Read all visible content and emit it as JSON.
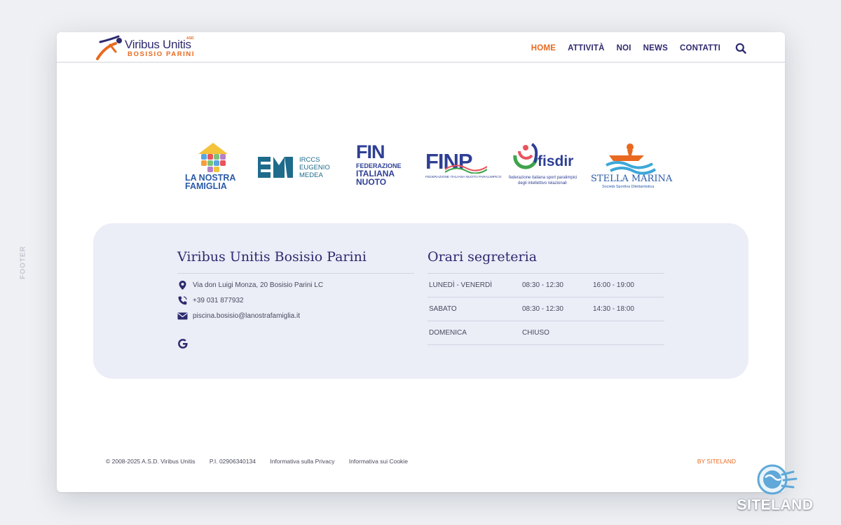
{
  "side_label": "FOOTER",
  "header": {
    "brand": "Viribus Unitis",
    "brand_badge": "ASD",
    "brand_sub": "BOSISIO PARINI",
    "nav": [
      "HOME",
      "ATTIVITÀ",
      "NOI",
      "NEWS",
      "CONTATTI"
    ],
    "active_nav": "HOME"
  },
  "partners": [
    {
      "name": "La Nostra Famiglia",
      "line1": "LA NOSTRA",
      "line2": "FAMIGLIA"
    },
    {
      "name": "IRCCS Eugenio Medea",
      "line1": "IRCCS",
      "line2": "EUGENIO",
      "line3": "MEDEA"
    },
    {
      "name": "FIN",
      "line1": "FIN",
      "line2": "FEDERAZIONE",
      "line3": "ITALIANA",
      "line4": "NUOTO"
    },
    {
      "name": "FINP",
      "line1": "FINP",
      "line2": "FEDERAZIONE ITALIANA NUOTO PARALIMPICO"
    },
    {
      "name": "FISDIR",
      "line1": "fisdir",
      "line2": "federazione italiana sport paralimpici",
      "line3": "degli intellettivo relazionali"
    },
    {
      "name": "Stella Marina",
      "line1": "STELLA MARINA",
      "line2": "Società Sportiva Dilettantistica"
    }
  ],
  "contacts": {
    "title": "Viribus Unitis Bosisio Parini",
    "address": "Via don Luigi Monza, 20 Bosisio Parini LC",
    "phone": "+39 031 877932",
    "email": "piscina.bosisio@lanostrafamiglia.it"
  },
  "hours": {
    "title": "Orari segreteria",
    "rows": [
      {
        "day": "LUNEDÌ - VENERDÌ",
        "t1": "08:30 - 12:30",
        "t2": "16:00 - 19:00"
      },
      {
        "day": "SABATO",
        "t1": "08:30 - 12:30",
        "t2": "14:30 - 18:00"
      },
      {
        "day": "DOMENICA",
        "t1": "CHIUSO",
        "t2": ""
      }
    ]
  },
  "footer": {
    "copyright": "© 2008-2025 A.S.D. Viribus Unitis",
    "vat": "P.I. 02906340134",
    "privacy": "Informativa sulla Privacy",
    "cookie": "Informativa sui Cookie",
    "credit": "BY SITELAND"
  },
  "watermark": "SITELAND",
  "colors": {
    "accent": "#e8691f",
    "brand": "#2d2a6e",
    "card_bg": "#ebedf7"
  }
}
